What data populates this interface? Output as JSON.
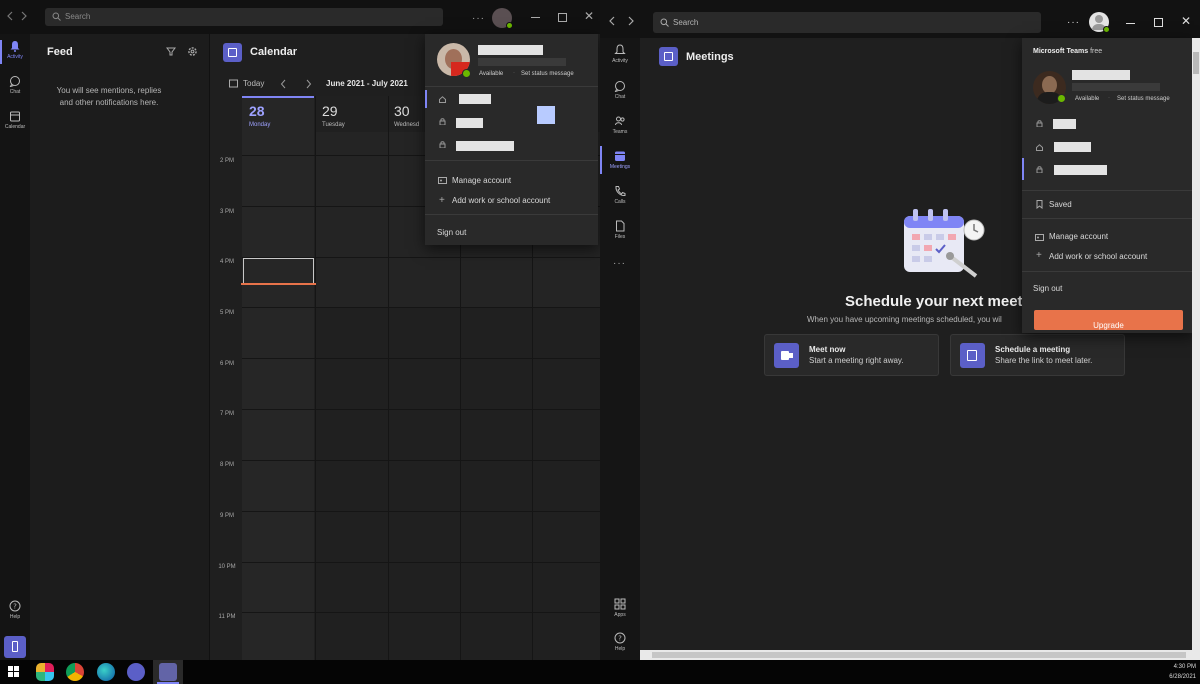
{
  "left_window": {
    "search_placeholder": "Search",
    "rail": [
      {
        "label": "Activity",
        "icon": "bell-icon"
      },
      {
        "label": "Chat",
        "icon": "chat-icon"
      },
      {
        "label": "Calendar",
        "icon": "calendar-icon"
      }
    ],
    "rail_bottom": {
      "help_label": "Help"
    },
    "feed": {
      "title": "Feed",
      "empty_text_line1": "You will see mentions, replies",
      "empty_text_line2": "and other notifications here."
    },
    "calendar": {
      "title": "Calendar",
      "today_label": "Today",
      "range_label": "June 2021 - July 2021",
      "days": [
        {
          "num": "28",
          "name": "Monday",
          "active": true
        },
        {
          "num": "29",
          "name": "Tuesday",
          "active": false
        },
        {
          "num": "30",
          "name": "Wednesd",
          "active": false
        }
      ],
      "hours": [
        "2 PM",
        "3 PM",
        "4 PM",
        "5 PM",
        "6 PM",
        "7 PM",
        "8 PM",
        "9 PM",
        "10 PM",
        "11 PM"
      ]
    },
    "profile_popup": {
      "status": "Available",
      "status_message": "Set status message",
      "manage_account": "Manage account",
      "add_account": "Add work or school account",
      "sign_out": "Sign out"
    }
  },
  "right_window": {
    "search_placeholder": "Search",
    "rail": [
      {
        "label": "Activity",
        "icon": "bell-icon"
      },
      {
        "label": "Chat",
        "icon": "chat-icon"
      },
      {
        "label": "Teams",
        "icon": "teams-icon"
      },
      {
        "label": "Meetings",
        "icon": "meetings-icon"
      },
      {
        "label": "Calls",
        "icon": "phone-icon"
      },
      {
        "label": "Files",
        "icon": "file-icon"
      }
    ],
    "rail_bottom": {
      "apps_label": "Apps",
      "help_label": "Help"
    },
    "meetings": {
      "title": "Meetings",
      "headline": "Schedule your next meet",
      "subtext": "When you have upcoming meetings scheduled, you wil",
      "meet_now_title": "Meet now",
      "meet_now_sub": "Start a meeting right away.",
      "schedule_title": "Schedule a meeting",
      "schedule_sub": "Share the link to meet later."
    },
    "profile_popup": {
      "product": "Microsoft Teams",
      "tier": "free",
      "status": "Available",
      "status_message": "Set status message",
      "saved": "Saved",
      "manage_account": "Manage account",
      "add_account": "Add work or school account",
      "sign_out": "Sign out",
      "upgrade": "Upgrade"
    }
  },
  "taskbar": {
    "time": "4:30 PM",
    "date": "6/28/2021"
  },
  "colors": {
    "accent": "#7f85f5",
    "brand_tile": "#5b5fc7",
    "upgrade": "#e8734a",
    "presence": "#6bb700",
    "now_line": "#e8734a"
  }
}
